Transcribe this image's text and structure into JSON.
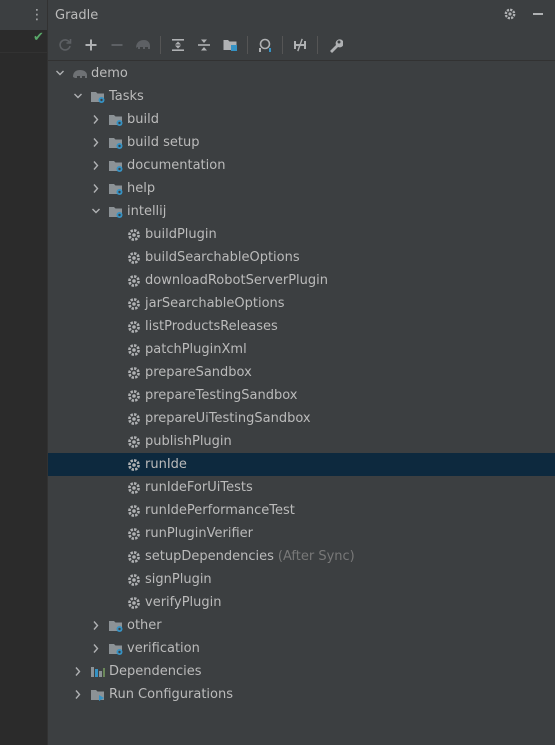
{
  "panel": {
    "title": "Gradle"
  },
  "toolbar": {
    "buttons": [
      {
        "icon": "refresh-icon",
        "enabled": false
      },
      {
        "icon": "plus-icon",
        "enabled": true
      },
      {
        "icon": "minus-icon",
        "enabled": false
      },
      {
        "icon": "elephant-icon",
        "enabled": false
      },
      {
        "icon": "expand-all-icon",
        "enabled": true
      },
      {
        "icon": "collapse-all-icon",
        "enabled": true
      },
      {
        "icon": "group-modules-icon",
        "enabled": true
      },
      {
        "icon": "analyze-dependencies-icon",
        "enabled": true
      },
      {
        "icon": "toggle-offline-icon",
        "enabled": true
      },
      {
        "icon": "build-tool-settings-icon",
        "enabled": true
      }
    ]
  },
  "tree": {
    "root": "demo",
    "tasks_label": "Tasks",
    "groups_before": [
      "build",
      "build setup",
      "documentation",
      "help"
    ],
    "intellij_label": "intellij",
    "intellij_tasks": [
      "buildPlugin",
      "buildSearchableOptions",
      "downloadRobotServerPlugin",
      "jarSearchableOptions",
      "listProductsReleases",
      "patchPluginXml",
      "prepareSandbox",
      "prepareTestingSandbox",
      "prepareUiTestingSandbox",
      "publishPlugin",
      "runIde",
      "runIdeForUiTests",
      "runIdePerformanceTest",
      "runPluginVerifier",
      "setupDependencies",
      "signPlugin",
      "verifyPlugin"
    ],
    "setup_suffix": "(After Sync)",
    "selected_task": "runIde",
    "groups_after": [
      "other",
      "verification"
    ],
    "dependencies_label": "Dependencies",
    "run_configs_label": "Run Configurations"
  },
  "colors": {
    "panel_bg": "#3c3f41",
    "selection": "#0d293e",
    "text": "#bbbbbb",
    "muted_text": "#787878",
    "gradle_blue": "#3592c4"
  }
}
